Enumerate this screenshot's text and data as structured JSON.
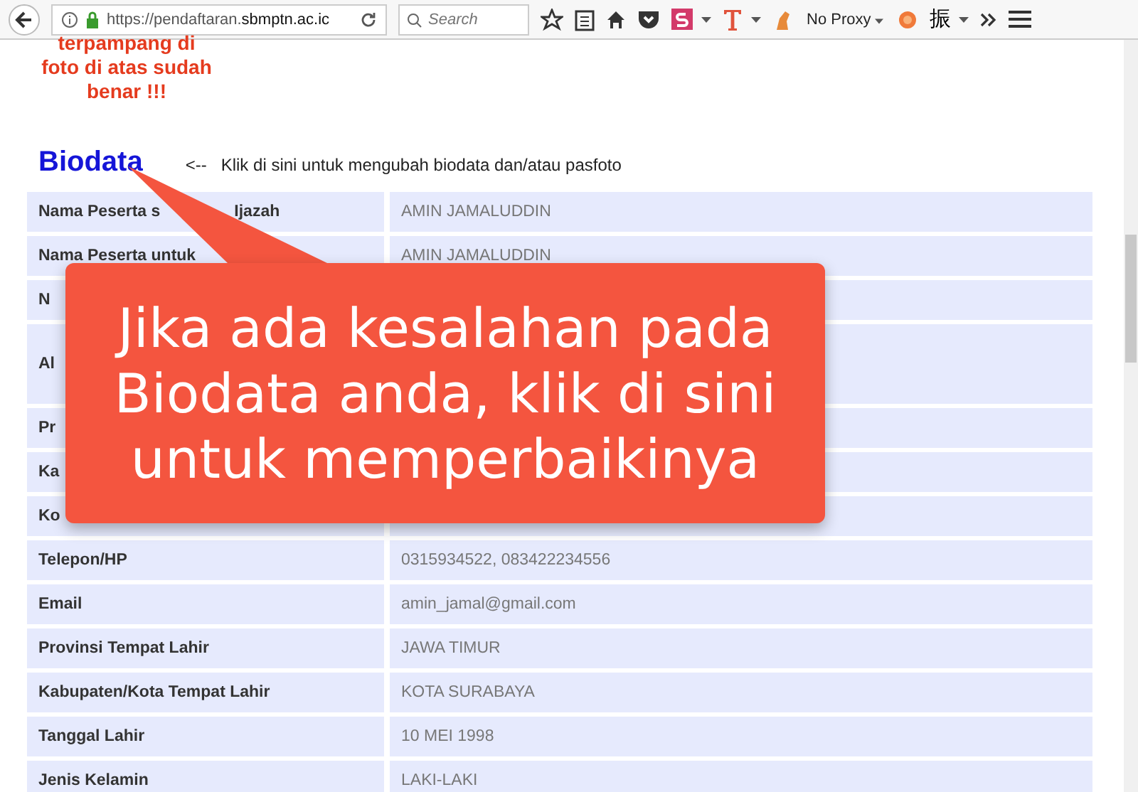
{
  "browser": {
    "url_prefix": "https://pendaftaran.",
    "url_host": "sbmptn.ac.ic",
    "search_placeholder": "Search",
    "proxy": "No Proxy",
    "cjk_button": "振"
  },
  "notice_lines": [
    "terpampang di",
    "foto di atas sudah",
    "benar !!!"
  ],
  "heading": {
    "title": "Biodata",
    "hint": "<--   Klik di sini untuk mengubah biodata dan/atau pasfoto"
  },
  "rows": [
    {
      "label": "Nama Peserta s",
      "label_tail": "Ijazah",
      "value": "AMIN JAMALUDDIN",
      "kind": "normal"
    },
    {
      "label": "Nama Peserta untuk",
      "value": "AMIN JAMALUDDIN",
      "kind": "normal"
    },
    {
      "label": "N",
      "kind": "normal"
    },
    {
      "label": "Al",
      "kind": "tall"
    },
    {
      "label": "Pr",
      "kind": "normal"
    },
    {
      "label": "Ka",
      "kind": "normal"
    },
    {
      "label": "Ko",
      "kind": "normal"
    },
    {
      "label": "Telepon/HP",
      "value": "0315934522, 083422234556",
      "kind": "normal"
    },
    {
      "label": "Email",
      "value": "amin_jamal@gmail.com",
      "kind": "normal"
    },
    {
      "label": "Provinsi Tempat Lahir",
      "value": "JAWA TIMUR",
      "kind": "normal"
    },
    {
      "label": "Kabupaten/Kota Tempat Lahir",
      "value": "KOTA SURABAYA",
      "kind": "normal"
    },
    {
      "label": "Tanggal Lahir",
      "value": "10 MEI 1998",
      "kind": "normal"
    },
    {
      "label": "Jenis Kelamin",
      "value": "LAKI-LAKI",
      "kind": "normal"
    }
  ],
  "callout": {
    "text": "Jika ada kesalahan pada Biodata anda, klik di sini untuk memperbaikinya"
  }
}
